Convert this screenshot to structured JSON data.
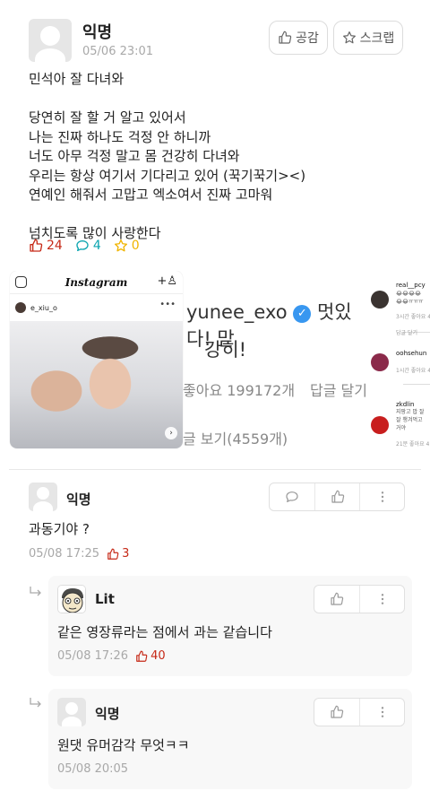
{
  "post": {
    "author": "익명",
    "time": "05/06 23:01",
    "like_button": "공감",
    "scrap_button": "스크랩",
    "body": "민석아 잘 다녀와\n\n당연히 잘 할 거 알고 있어서\n나는 진짜 하나도 걱정 안 하니까\n너도 아무 걱정 말고 몸 건강히 다녀와\n우리는 항상 여기서 기다리고 있어 (꾹기꾹기><)\n연예인 해줘서 고맙고 엑소여서 진짜 고마워\n\n넘치도록 많이 사랑한다",
    "stats": {
      "likes": "24",
      "comments": "4",
      "scraps": "0"
    }
  },
  "photo": {
    "instagram": {
      "app_title": "Instagram",
      "username": "e_xiu_o"
    },
    "middle": {
      "handle": "yunee_exo",
      "caption_suffix": "멋있다! 맏",
      "line2": "강히!",
      "likes": "좋아요 199172개",
      "reply": "답글 달기",
      "view_replies": "글 보기(4559개)"
    },
    "side_comments": [
      {
        "name": "real__pcy",
        "text": "😂😂😂😂\n😂😂ㅠㅠㅠ",
        "meta": "3시간   좋아요 4",
        "color": "#3a3330"
      },
      {
        "name": "oohsehun",
        "text": "",
        "meta": "1시간   좋아요 4",
        "color": "#8b2a4a"
      },
      {
        "name": "zkdlin",
        "text": "지팡고 밥 잘\n잘 챙겨먹고\n거야",
        "meta": "21분   좋아요 4",
        "color": "#c81e1e"
      }
    ],
    "reply_label": "답글 달기"
  },
  "comments": [
    {
      "author": "익명",
      "text": "과동기야 ?",
      "time": "05/08 17:25",
      "likes": "3"
    }
  ],
  "replies": [
    {
      "author": "Lit",
      "text": "같은 영장류라는 점에서 과는 같습니다",
      "time": "05/08 17:26",
      "likes": "40"
    },
    {
      "author": "익명",
      "text": "원댓 유머감각 무엇ㅋㅋ",
      "time": "05/08 20:05"
    }
  ],
  "colors": {
    "like": "#c62917",
    "comment": "#0ca5b0",
    "scrap": "#f0b400",
    "meta_gray": "#a8a8a8"
  }
}
